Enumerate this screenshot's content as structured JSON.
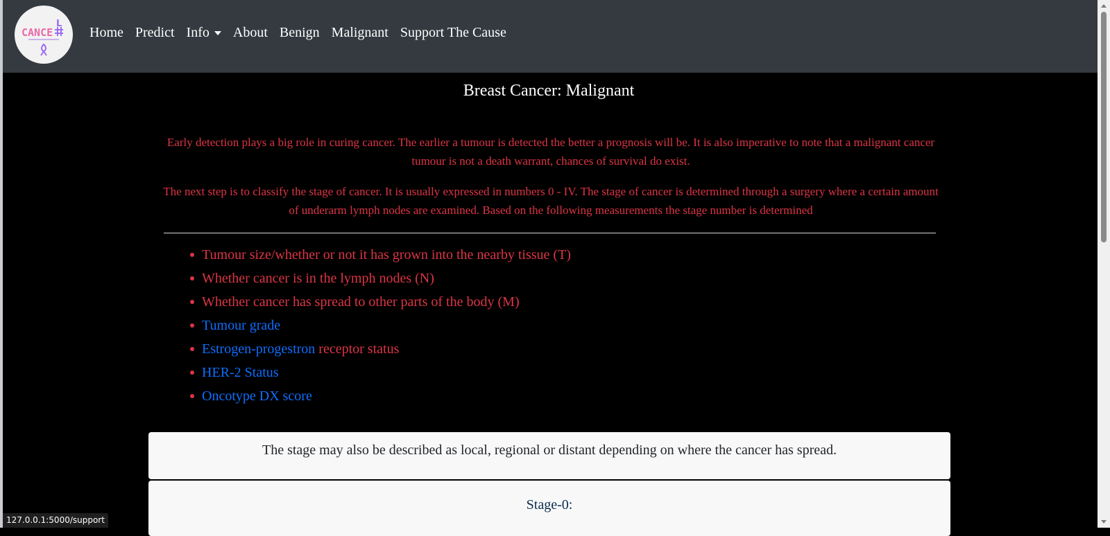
{
  "nav": {
    "logo_text": "CANCE",
    "logo_letter": "L",
    "links": [
      {
        "label": "Home"
      },
      {
        "label": "Predict"
      },
      {
        "label": "Info",
        "dropdown": true
      },
      {
        "label": "About"
      },
      {
        "label": "Benign"
      },
      {
        "label": "Malignant"
      },
      {
        "label": "Support The Cause"
      }
    ]
  },
  "page": {
    "title": "Breast Cancer: Malignant",
    "paragraph1": "Early detection plays a big role in curing cancer. The earlier a tumour is detected the better a prognosis will be. It is also imperative to note that a malignant cancer tumour is not a death warrant, chances of survival do exist.",
    "paragraph2": "The next step is to classify the stage of cancer. It is usually expressed in numbers 0 - IV. The stage of cancer is determined through a surgery where a certain amount of underarm lymph nodes are examined. Based on the following measurements the stage number is determined",
    "list": [
      {
        "text": "Tumour size/whether or not it has grown into the nearby tissue (T)",
        "link_part": "",
        "rest": ""
      },
      {
        "text": "Whether cancer is in the lymph nodes (N)",
        "link_part": "",
        "rest": ""
      },
      {
        "text": "Whether cancer has spread to other parts of the body (M)",
        "link_part": "",
        "rest": ""
      },
      {
        "text": "",
        "link_part": "Tumour grade",
        "rest": ""
      },
      {
        "text": "",
        "link_part": "Estrogen-progestron",
        "rest": " receptor status"
      },
      {
        "text": "",
        "link_part": "HER-2 Status",
        "rest": ""
      },
      {
        "text": "",
        "link_part": "Oncotype DX score",
        "rest": ""
      }
    ],
    "card1_text": "The stage may also be described as local, regional or distant depending on where the cancer has spread.",
    "card2_text": "Stage-0:"
  },
  "status_bar": {
    "url": "127.0.0.1:5000/support"
  },
  "colors": {
    "accent_red": "#dc3545",
    "link_blue": "#0d6efd",
    "navbar": "#343a40"
  }
}
